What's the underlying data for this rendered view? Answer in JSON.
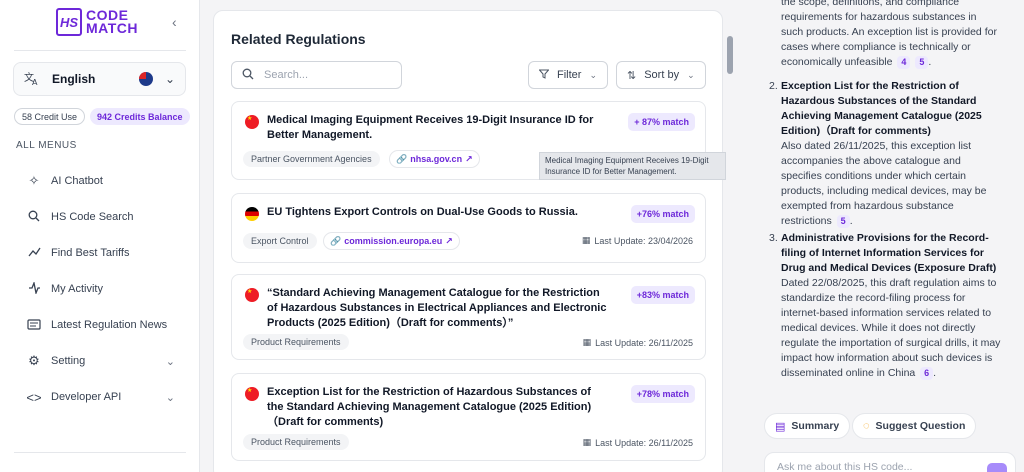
{
  "brand": {
    "mark": "HS",
    "line1": "CODE",
    "line2": "MATCH",
    "accent": "#6d28d9"
  },
  "sidebar": {
    "language": "English",
    "credit_use": "58 Credit Use",
    "credit_balance": "942 Credits Balance",
    "menu_heading": "ALL MENUS",
    "items": [
      {
        "label": "AI Chatbot",
        "icon": "sparkle-icon"
      },
      {
        "label": "HS Code Search",
        "icon": "search-icon"
      },
      {
        "label": "Find Best Tariffs",
        "icon": "trend-icon"
      },
      {
        "label": "My Activity",
        "icon": "activity-icon"
      },
      {
        "label": "Latest Regulation News",
        "icon": "news-icon"
      },
      {
        "label": "Setting",
        "icon": "gear-icon"
      },
      {
        "label": "Developer API",
        "icon": "code-icon"
      }
    ]
  },
  "main": {
    "title": "Related Regulations",
    "search_placeholder": "Search...",
    "filter_label": "Filter",
    "sort_label": "Sort by",
    "tooltip": "Medical Imaging Equipment Receives 19-Digit Insurance ID for Better Management.",
    "cards": [
      {
        "flag": "china",
        "title": "Medical Imaging Equipment Receives 19-Digit Insurance ID for Better Management.",
        "match": "+ 87% match",
        "tag": "Partner Government Agencies",
        "link": "nhsa.gov.cn"
      },
      {
        "flag": "germany",
        "title": "EU Tightens Export Controls on Dual-Use Goods to Russia.",
        "match": "+76% match",
        "tag": "Export Control",
        "link": "commission.europa.eu",
        "update": "Last Update: 23/04/2026"
      },
      {
        "flag": "china",
        "title": "“Standard Achieving Management Catalogue for the Restriction of Hazardous Substances in Electrical Appliances and Electronic Products (2025 Edition)（Draft for comments）”",
        "match": "+83% match",
        "tag": "Product Requirements",
        "update": "Last Update: 26/11/2025"
      },
      {
        "flag": "china",
        "title": "Exception List for the Restriction of Hazardous Substances of the Standard Achieving Management Catalogue (2025 Edition)（Draft for comments)",
        "match": "+78% match",
        "tag": "Product Requirements",
        "update": "Last Update: 26/11/2025"
      }
    ]
  },
  "chat": {
    "intro": "the scope, definitions, and compliance requirements for hazardous substances in such products. An exception list is provided for cases where compliance is technically or economically unfeasible",
    "intro_cites": [
      "4",
      "5"
    ],
    "items": [
      {
        "num": "2.",
        "title": "Exception List for the Restriction of Hazardous Substances of the Standard Achieving Management Catalogue (2025 Edition)（Draft for comments)",
        "body": "Also dated 26/11/2025, this exception list accompanies the above catalogue and specifies conditions under which certain products, including medical devices, may be exempted from hazardous substance restrictions",
        "cites": [
          "5"
        ]
      },
      {
        "num": "3.",
        "title": "Administrative Provisions for the Record-filing of Internet Information Services for Drug and Medical Devices (Exposure Draft)",
        "body": "Dated 22/08/2025, this draft regulation aims to standardize the record-filing process for internet-based information services related to medical devices. While it does not directly regulate the importation of surgical drills, it may impact how information about such devices is disseminated online in China",
        "cites": [
          "6"
        ]
      }
    ],
    "summary_label": "Summary",
    "suggest_label": "Suggest Question",
    "input_placeholder": "Ask me about this HS code..."
  }
}
